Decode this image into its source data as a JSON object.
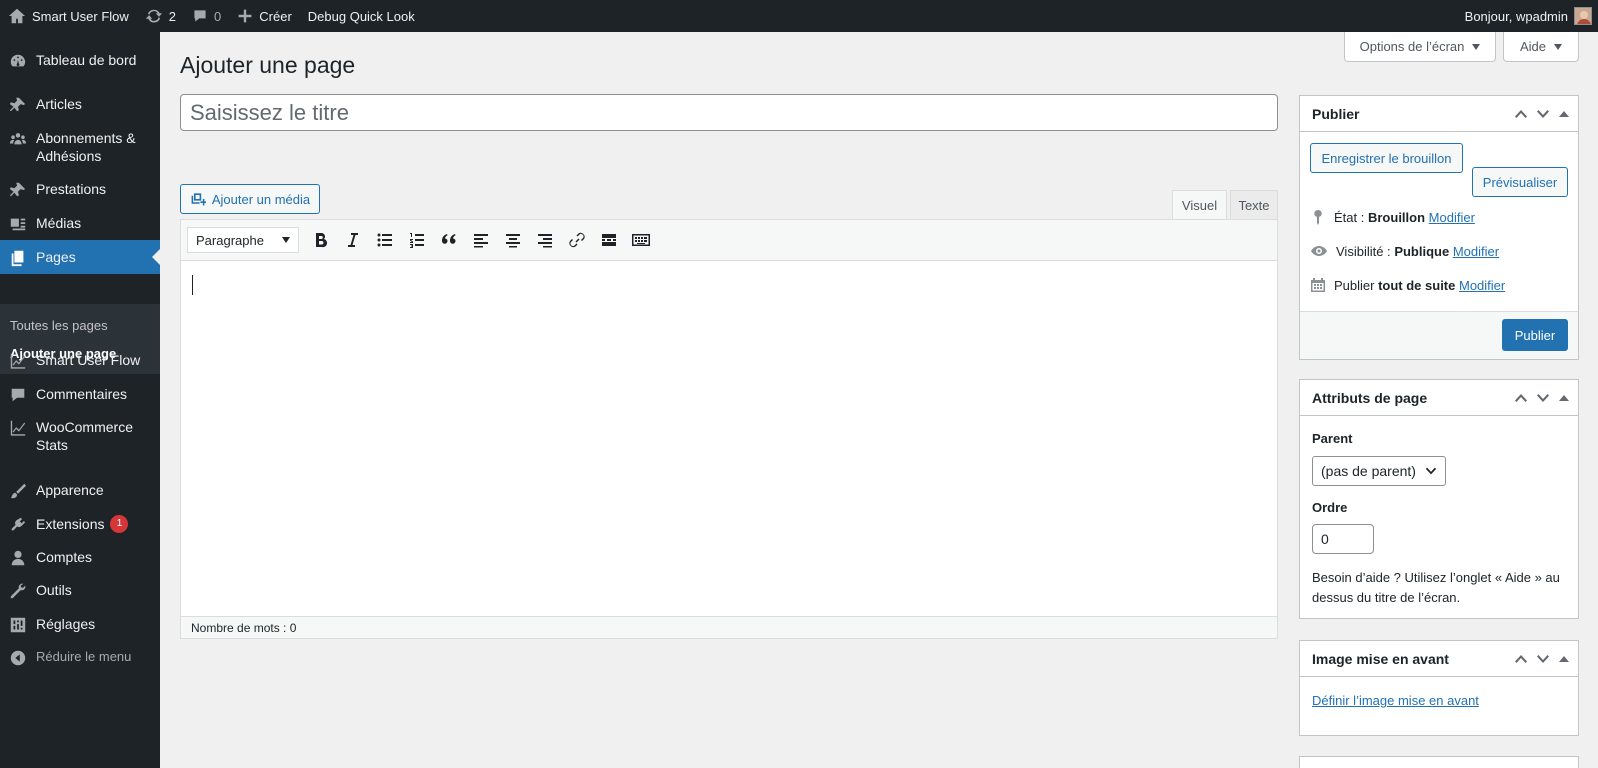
{
  "adminbar": {
    "site_name": "Smart User Flow",
    "updates_count": "2",
    "comments_count": "0",
    "new_label": "Créer",
    "debug_label": "Debug Quick Look",
    "greeting": "Bonjour, wpadmin"
  },
  "sidebar": {
    "items": [
      {
        "label": "Tableau de bord",
        "icon": "dashboard-icon"
      },
      {
        "label": "Articles",
        "icon": "pin-icon"
      },
      {
        "label": "Abonnements & Adhésions",
        "icon": "groups-icon"
      },
      {
        "label": "Prestations",
        "icon": "pin-icon"
      },
      {
        "label": "Médias",
        "icon": "media-icon"
      },
      {
        "label": "Pages",
        "icon": "pages-icon"
      },
      {
        "label": "Smart User Flow",
        "icon": "chart-line-icon"
      },
      {
        "label": "Commentaires",
        "icon": "comment-icon"
      },
      {
        "label": "WooCommerce Stats",
        "icon": "chart-line-icon"
      },
      {
        "label": "Apparence",
        "icon": "brush-icon"
      },
      {
        "label": "Extensions",
        "icon": "plugin-icon",
        "badge": "1"
      },
      {
        "label": "Comptes",
        "icon": "user-icon"
      },
      {
        "label": "Outils",
        "icon": "wrench-icon"
      },
      {
        "label": "Réglages",
        "icon": "settings-icon"
      }
    ],
    "submenu": [
      "Toutes les pages",
      "Ajouter une page"
    ],
    "collapse_label": "Réduire le menu"
  },
  "screen_options_label": "Options de l’écran",
  "help_label": "Aide",
  "page_title": "Ajouter une page",
  "title_placeholder": "Saisissez le titre",
  "editor": {
    "add_media_label": "Ajouter un média",
    "tab_visual": "Visuel",
    "tab_text": "Texte",
    "format_select": "Paragraphe",
    "word_count": "Nombre de mots : 0"
  },
  "publish": {
    "title": "Publier",
    "save_draft": "Enregistrer le brouillon",
    "preview": "Prévisualiser",
    "status_label": "État :",
    "status_value": "Brouillon",
    "visibility_label": "Visibilité :",
    "visibility_value": "Publique",
    "schedule_label": "Publier",
    "schedule_value": "tout de suite",
    "edit_link": "Modifier",
    "publish_button": "Publier"
  },
  "page_attributes": {
    "title": "Attributs de page",
    "parent_label": "Parent",
    "parent_value": "(pas de parent)",
    "order_label": "Ordre",
    "order_value": "0",
    "help_text": "Besoin d’aide ? Utilisez l’onglet « Aide » au dessus du titre de l’écran."
  },
  "featured_image": {
    "title": "Image mise en avant",
    "set_link": "Définir l’image mise en avant"
  },
  "colors": {
    "admin_dark": "#1d2327",
    "accent": "#2271b1",
    "badge": "#d63638"
  }
}
